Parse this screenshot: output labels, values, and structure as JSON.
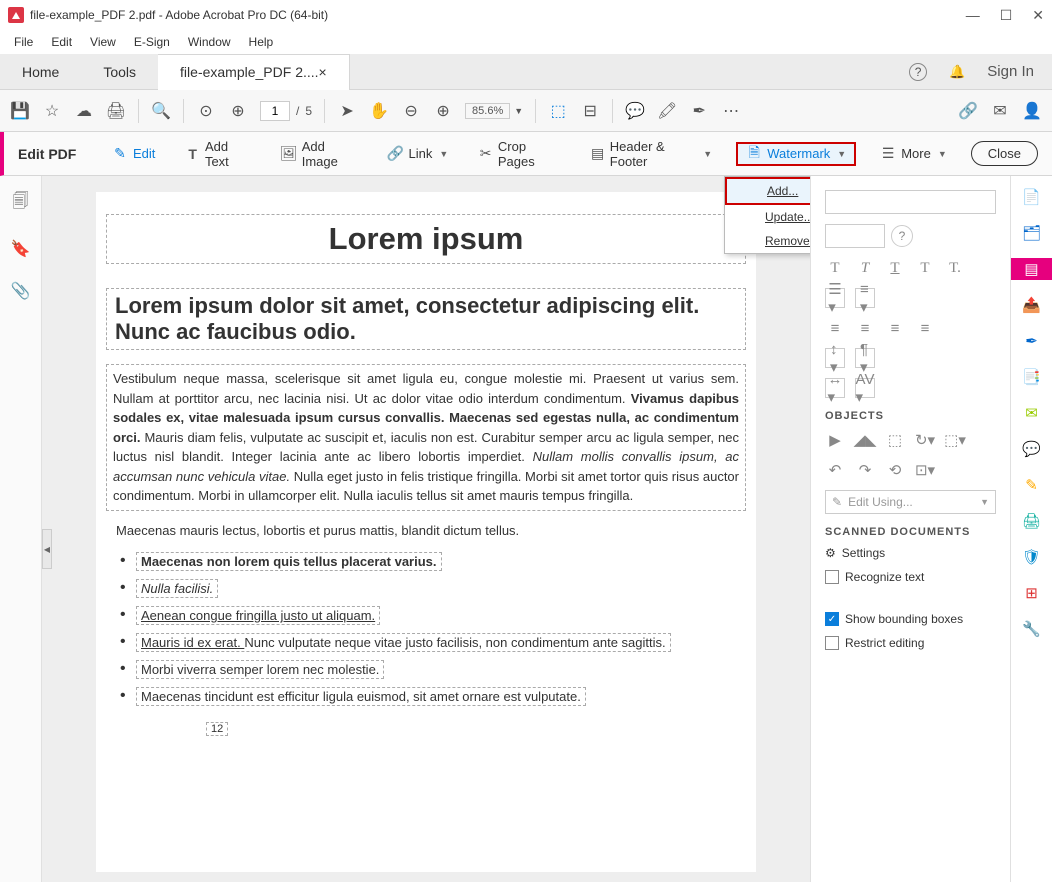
{
  "window": {
    "title": "file-example_PDF 2.pdf - Adobe Acrobat Pro DC (64-bit)"
  },
  "menubar": [
    "File",
    "Edit",
    "View",
    "E-Sign",
    "Window",
    "Help"
  ],
  "tabs": {
    "home": "Home",
    "tools": "Tools",
    "active": "file-example_PDF 2....",
    "sign_in": "Sign In"
  },
  "toolbar": {
    "page_current": "1",
    "page_sep": "/",
    "page_total": "5",
    "zoom": "85.6%"
  },
  "edit_toolbar": {
    "title": "Edit PDF",
    "edit": "Edit",
    "add_text": "Add Text",
    "add_image": "Add Image",
    "link": "Link",
    "crop": "Crop Pages",
    "header_footer": "Header & Footer",
    "watermark": "Watermark",
    "more": "More",
    "close": "Close"
  },
  "watermark_menu": {
    "add": "Add...",
    "update": "Update...",
    "remove": "Remove..."
  },
  "document": {
    "title": "Lorem ipsum",
    "subtitle": "Lorem ipsum dolor sit amet, consectetur adipiscing elit. Nunc ac faucibus odio.",
    "para1_a": "Vestibulum neque massa, scelerisque sit amet ligula eu, congue molestie mi. Praesent ut varius sem. Nullam at porttitor arcu, nec lacinia nisi. Ut ac dolor vitae odio interdum condimentum. ",
    "para1_b": "Vivamus dapibus sodales ex, vitae malesuada ipsum cursus convallis. Maecenas sed egestas nulla, ac condimentum orci.",
    "para1_c": " Mauris diam felis, vulputate ac suscipit et, iaculis non est. Curabitur semper arcu ac ligula semper, nec luctus nisl blandit. Integer lacinia ante ac libero lobortis imperdiet. ",
    "para1_d": "Nullam mollis convallis ipsum, ac accumsan nunc vehicula vitae.",
    "para1_e": " Nulla eget justo in felis tristique fringilla. Morbi sit amet tortor quis risus auctor condimentum. Morbi in ullamcorper elit. Nulla iaculis tellus sit amet mauris tempus fringilla.",
    "para2": "Maecenas mauris lectus, lobortis et purus mattis, blandit dictum tellus.",
    "bullets": [
      {
        "text": "Maecenas non lorem quis tellus placerat varius.",
        "bold": true
      },
      {
        "text": "Nulla facilisi.",
        "italic": true
      },
      {
        "text": "Aenean congue fringilla justo ut aliquam. ",
        "underline": true
      },
      {
        "text_a": "Mauris id ex erat. ",
        "text_b": "Nunc vulputate neque vitae justo facilisis, non condimentum ante sagittis.",
        "underline_a": true
      },
      {
        "text": "Morbi viverra semper lorem nec molestie."
      },
      {
        "text": "Maecenas tincidunt est efficitur ligula euismod, sit amet ornare est vulputate."
      }
    ],
    "page_num": "12"
  },
  "right_panel": {
    "objects": "OBJECTS",
    "edit_using": "Edit Using...",
    "scanned": "SCANNED DOCUMENTS",
    "settings": "Settings",
    "recognize": "Recognize text",
    "show_bounding": "Show bounding boxes",
    "restrict": "Restrict editing"
  }
}
